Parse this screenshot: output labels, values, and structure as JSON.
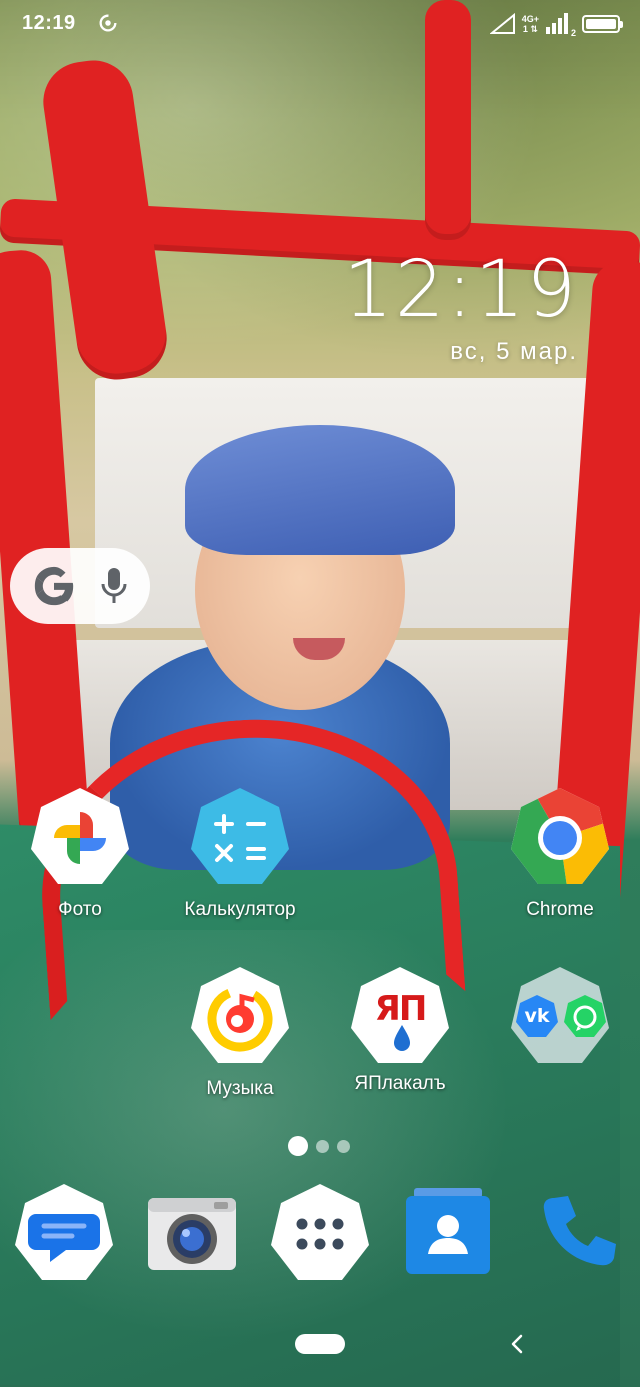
{
  "status_bar": {
    "time": "12:19",
    "network_type": "4G+",
    "sim_slot_1": "1",
    "sim_slot_2": "2"
  },
  "clock_widget": {
    "time": "12:19",
    "date": "вс, 5 мар."
  },
  "search_widget": {
    "google_icon": "google-g-icon",
    "mic_icon": "microphone-icon"
  },
  "apps": {
    "row1": [
      {
        "label": "Фото",
        "icon": "google-photos-icon"
      },
      {
        "label": "Калькулятор",
        "icon": "calculator-icon"
      },
      {
        "label": "Chrome",
        "icon": "chrome-icon"
      }
    ],
    "row2": [
      {
        "label": "Музыка",
        "icon": "music-icon"
      },
      {
        "label": "ЯПлакалъ",
        "icon": "yaplakal-icon"
      },
      {
        "label": "",
        "icon": "vk-whatsapp-folder-icon"
      }
    ],
    "dock": [
      {
        "label": "",
        "icon": "messages-icon"
      },
      {
        "label": "",
        "icon": "camera-icon"
      },
      {
        "label": "",
        "icon": "app-drawer-icon"
      },
      {
        "label": "",
        "icon": "contacts-icon"
      },
      {
        "label": "",
        "icon": "phone-icon"
      }
    ]
  },
  "page_indicator": {
    "pages": 3,
    "current": 1
  },
  "yaplakal_logo_text": "ЯП",
  "vk_logo_text": "vk",
  "colors": {
    "accent_red": "#e02222",
    "google_blue": "#4285F4",
    "google_red": "#EA4335",
    "google_yellow": "#FBBC05",
    "google_green": "#34A853",
    "calc_blue": "#3dbbe6",
    "vk_blue": "#2787f5",
    "whatsapp_green": "#25d366",
    "contacts_blue": "#1e88e5"
  }
}
